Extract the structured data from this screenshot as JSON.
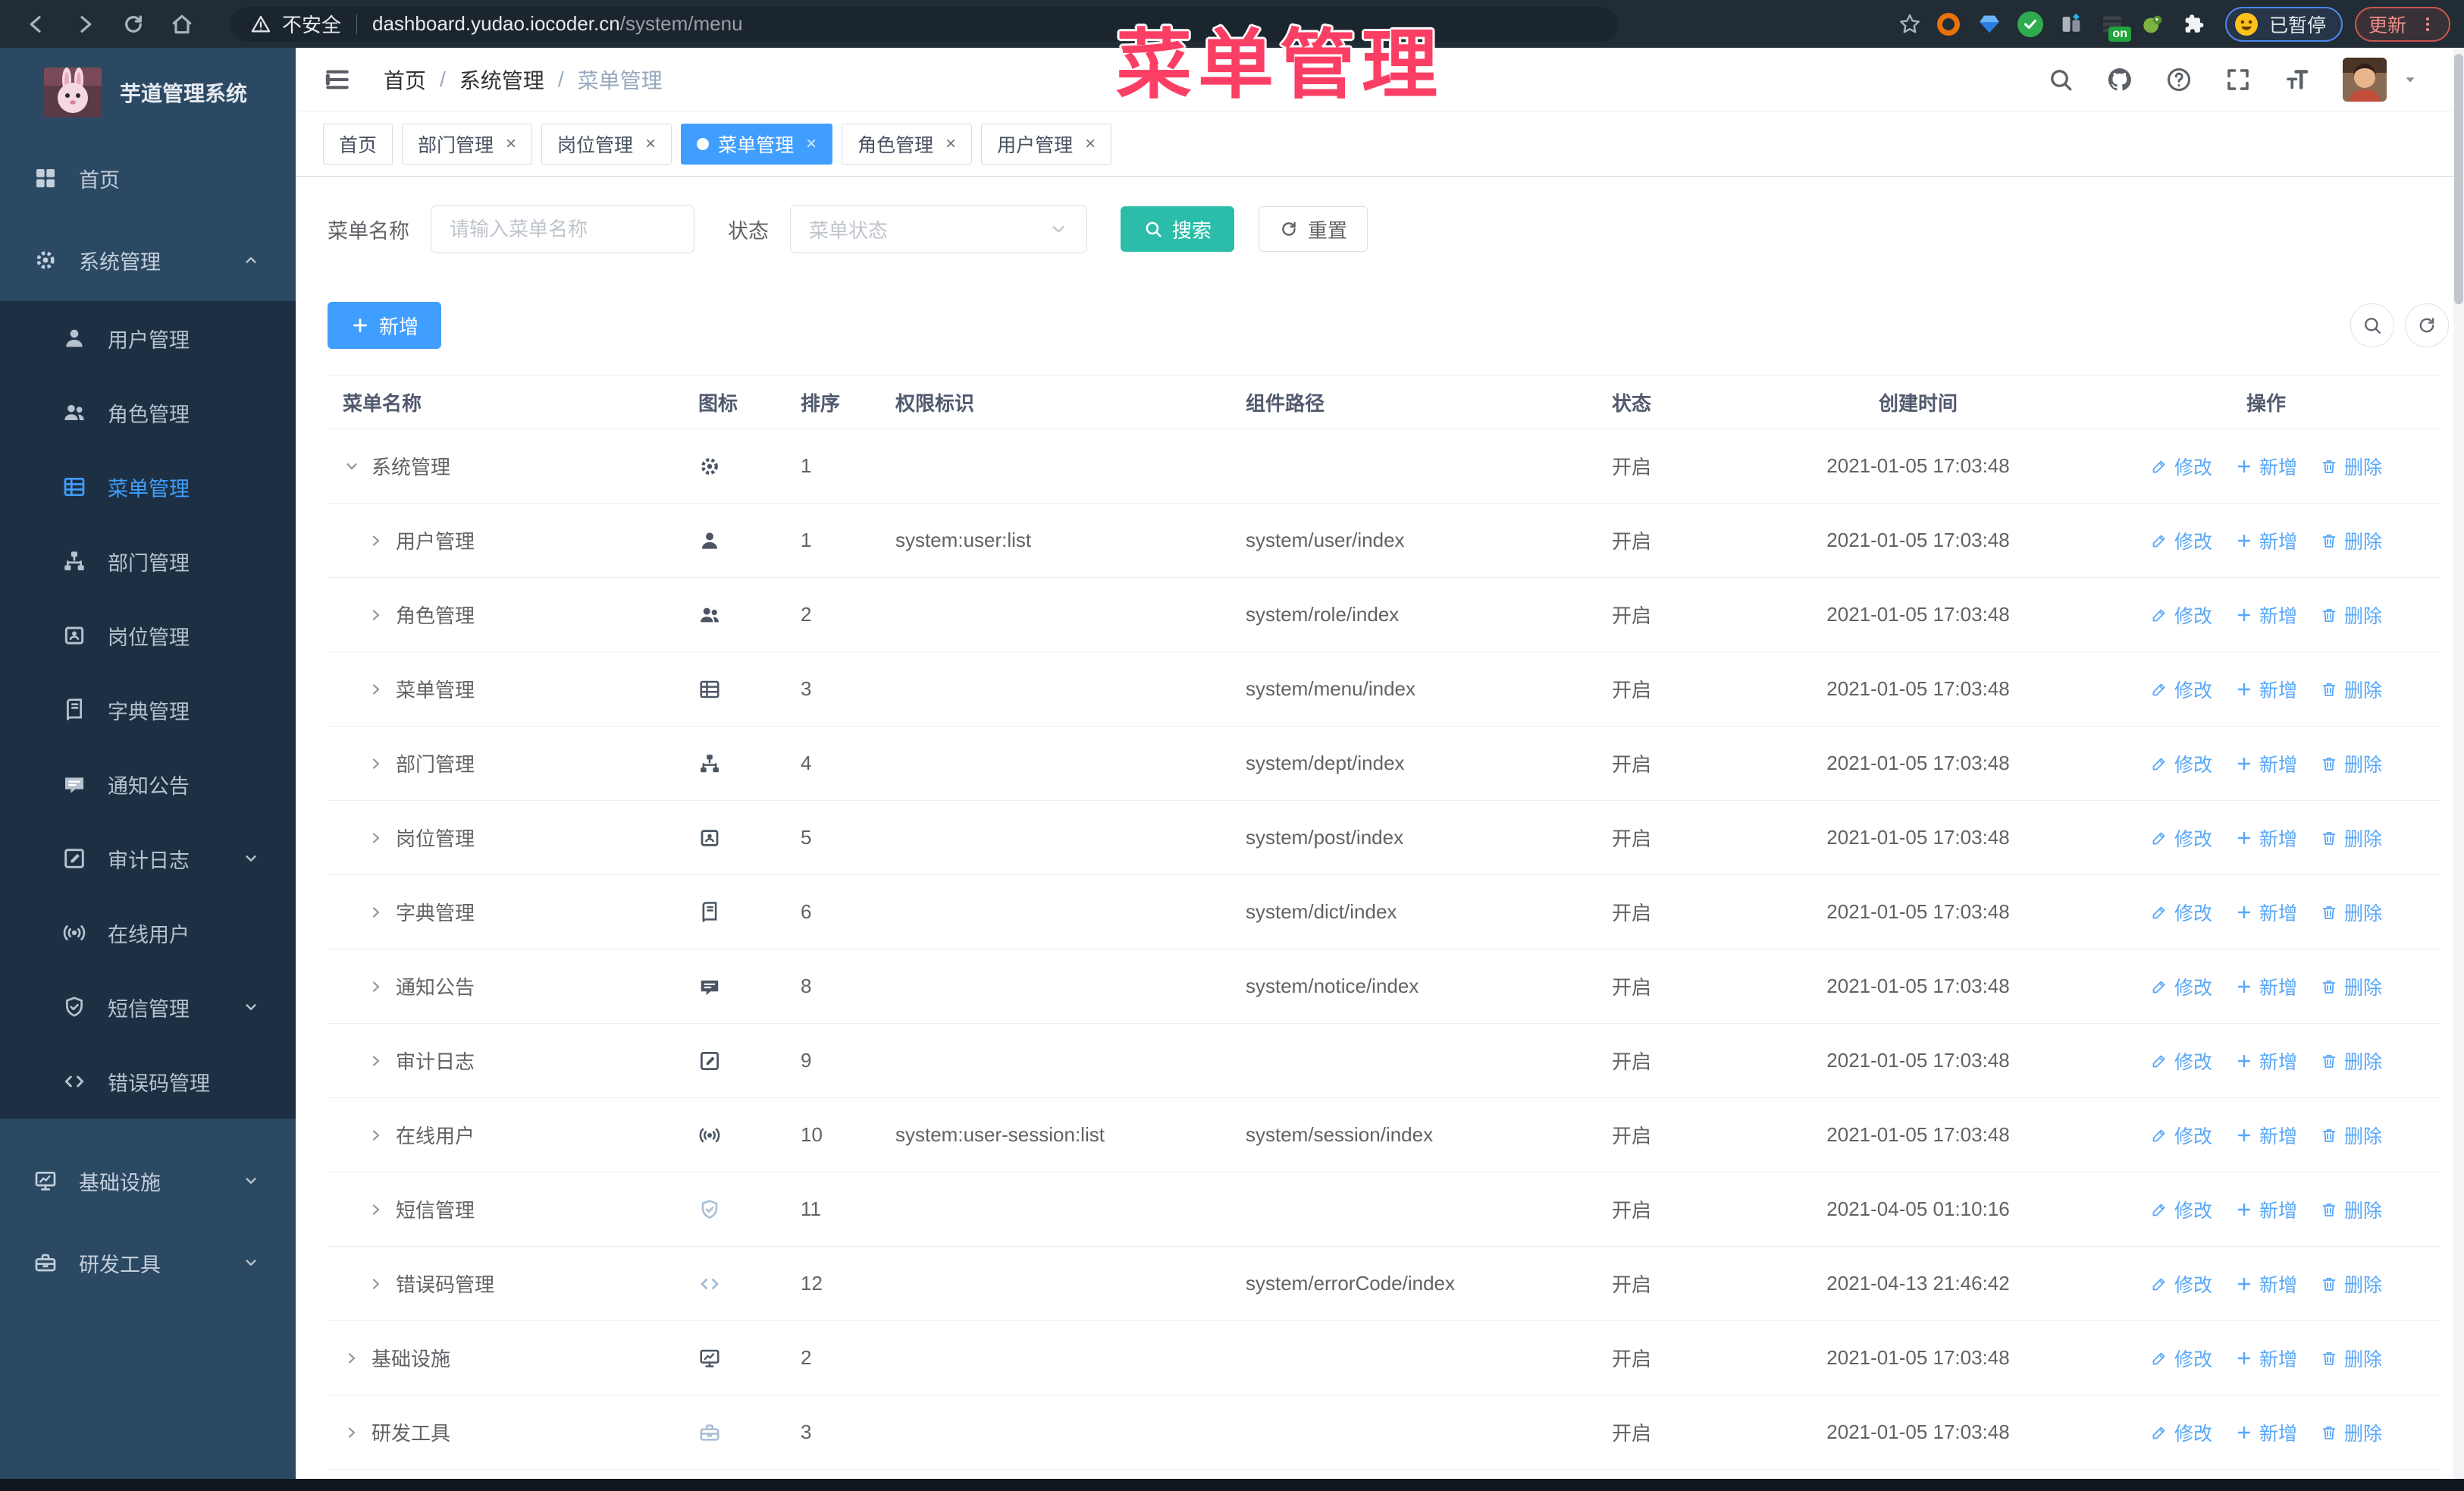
{
  "browser": {
    "security_label": "不安全",
    "url_host": "dashboard.yudao.iocoder.cn",
    "url_path": "/system/menu",
    "profile_status": "已暂停",
    "update_label": "更新",
    "ext_badge": "on"
  },
  "watermark": "菜单管理",
  "sidebar": {
    "logo_title": "芋道管理系统",
    "items": [
      {
        "type": "item",
        "icon": "dashboard",
        "label": "首页"
      },
      {
        "type": "sub",
        "icon": "gear",
        "label": "系统管理",
        "expanded": true,
        "children": [
          {
            "icon": "user",
            "label": "用户管理"
          },
          {
            "icon": "users",
            "label": "角色管理"
          },
          {
            "icon": "tree-table",
            "label": "菜单管理",
            "active": true
          },
          {
            "icon": "tree",
            "label": "部门管理"
          },
          {
            "icon": "post",
            "label": "岗位管理"
          },
          {
            "icon": "dict",
            "label": "字典管理"
          },
          {
            "icon": "message",
            "label": "通知公告"
          },
          {
            "icon": "log",
            "label": "审计日志",
            "chevron": "down"
          },
          {
            "icon": "online",
            "label": "在线用户"
          },
          {
            "icon": "shield",
            "label": "短信管理",
            "chevron": "down"
          },
          {
            "icon": "code",
            "label": "错误码管理"
          }
        ]
      },
      {
        "type": "sub",
        "icon": "monitor",
        "label": "基础设施",
        "expanded": false
      },
      {
        "type": "sub",
        "icon": "toolbox",
        "label": "研发工具",
        "expanded": false
      }
    ]
  },
  "header": {
    "breadcrumb": [
      "首页",
      "系统管理",
      "菜单管理"
    ]
  },
  "tabs": [
    {
      "label": "首页",
      "closable": false,
      "active": false
    },
    {
      "label": "部门管理",
      "closable": true,
      "active": false
    },
    {
      "label": "岗位管理",
      "closable": true,
      "active": false
    },
    {
      "label": "菜单管理",
      "closable": true,
      "active": true
    },
    {
      "label": "角色管理",
      "closable": true,
      "active": false
    },
    {
      "label": "用户管理",
      "closable": true,
      "active": false
    }
  ],
  "filters": {
    "name_label": "菜单名称",
    "name_placeholder": "请输入菜单名称",
    "status_label": "状态",
    "status_placeholder": "菜单状态",
    "search_label": "搜索",
    "reset_label": "重置"
  },
  "toolbar": {
    "add_label": "新增"
  },
  "table": {
    "columns": [
      "菜单名称",
      "图标",
      "排序",
      "权限标识",
      "组件路径",
      "状态",
      "创建时间",
      "操作"
    ],
    "action_labels": {
      "edit": "修改",
      "add": "新增",
      "delete": "删除"
    },
    "rows": [
      {
        "name": "系统管理",
        "level": 0,
        "caret": "down",
        "icon": "gear",
        "sort": "1",
        "perm": "",
        "path": "",
        "status": "开启",
        "time": "2021-01-05 17:03:48"
      },
      {
        "name": "用户管理",
        "level": 1,
        "caret": "right",
        "icon": "user",
        "sort": "1",
        "perm": "system:user:list",
        "path": "system/user/index",
        "status": "开启",
        "time": "2021-01-05 17:03:48"
      },
      {
        "name": "角色管理",
        "level": 1,
        "caret": "right",
        "icon": "users",
        "sort": "2",
        "perm": "",
        "path": "system/role/index",
        "status": "开启",
        "time": "2021-01-05 17:03:48"
      },
      {
        "name": "菜单管理",
        "level": 1,
        "caret": "right",
        "icon": "tree-table",
        "sort": "3",
        "perm": "",
        "path": "system/menu/index",
        "status": "开启",
        "time": "2021-01-05 17:03:48"
      },
      {
        "name": "部门管理",
        "level": 1,
        "caret": "right",
        "icon": "tree",
        "sort": "4",
        "perm": "",
        "path": "system/dept/index",
        "status": "开启",
        "time": "2021-01-05 17:03:48"
      },
      {
        "name": "岗位管理",
        "level": 1,
        "caret": "right",
        "icon": "post",
        "sort": "5",
        "perm": "",
        "path": "system/post/index",
        "status": "开启",
        "time": "2021-01-05 17:03:48"
      },
      {
        "name": "字典管理",
        "level": 1,
        "caret": "right",
        "icon": "dict",
        "sort": "6",
        "perm": "",
        "path": "system/dict/index",
        "status": "开启",
        "time": "2021-01-05 17:03:48"
      },
      {
        "name": "通知公告",
        "level": 1,
        "caret": "right",
        "icon": "message",
        "sort": "8",
        "perm": "",
        "path": "system/notice/index",
        "status": "开启",
        "time": "2021-01-05 17:03:48"
      },
      {
        "name": "审计日志",
        "level": 1,
        "caret": "right",
        "icon": "log",
        "sort": "9",
        "perm": "",
        "path": "",
        "status": "开启",
        "time": "2021-01-05 17:03:48"
      },
      {
        "name": "在线用户",
        "level": 1,
        "caret": "right",
        "icon": "online",
        "sort": "10",
        "perm": "system:user-session:list",
        "path": "system/session/index",
        "status": "开启",
        "time": "2021-01-05 17:03:48"
      },
      {
        "name": "短信管理",
        "level": 1,
        "caret": "right",
        "icon": "shield",
        "iconLight": true,
        "sort": "11",
        "perm": "",
        "path": "",
        "status": "开启",
        "time": "2021-04-05 01:10:16"
      },
      {
        "name": "错误码管理",
        "level": 1,
        "caret": "right",
        "icon": "code",
        "iconLight": true,
        "sort": "12",
        "perm": "",
        "path": "system/errorCode/index",
        "status": "开启",
        "time": "2021-04-13 21:46:42"
      },
      {
        "name": "基础设施",
        "level": 0,
        "caret": "right",
        "icon": "monitor",
        "sort": "2",
        "perm": "",
        "path": "",
        "status": "开启",
        "time": "2021-01-05 17:03:48"
      },
      {
        "name": "研发工具",
        "level": 0,
        "caret": "right",
        "icon": "toolbox",
        "iconLight": true,
        "sort": "3",
        "perm": "",
        "path": "",
        "status": "开启",
        "time": "2021-01-05 17:03:48"
      }
    ]
  },
  "colors": {
    "accent_blue": "#409eff",
    "search_teal": "#2bbda9",
    "watermark_pink": "#fb3e63",
    "sidebar_bg": "#2c4963",
    "submenu_bg": "#1d3043",
    "link_blue": "#58a7f8"
  }
}
